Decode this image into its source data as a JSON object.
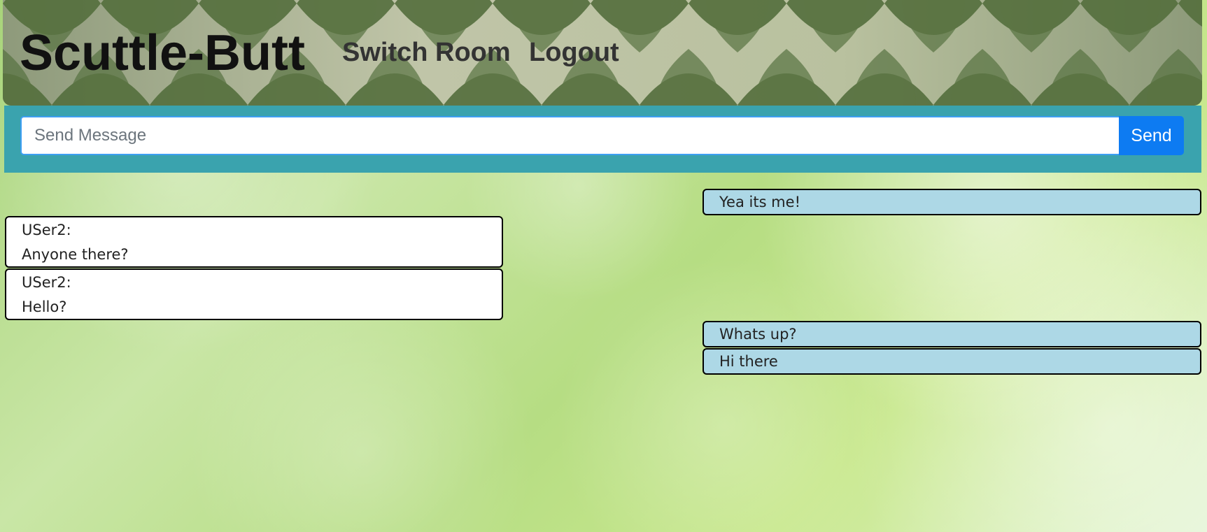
{
  "header": {
    "brand": "Scuttle-Butt",
    "nav": {
      "switch_room": "Switch Room",
      "logout": "Logout"
    }
  },
  "composer": {
    "placeholder": "Send Message",
    "value": "",
    "send_label": "Send"
  },
  "messages": {
    "sent": [
      {
        "text": "Yea its me!"
      },
      {
        "text": "Whats up?"
      },
      {
        "text": "Hi there"
      }
    ],
    "received": [
      {
        "user": "USer2:",
        "text": "Anyone there?"
      },
      {
        "user": "USer2:",
        "text": "Hello?"
      }
    ]
  },
  "colors": {
    "composer_bar": "#3aa3ae",
    "send_button": "#0d7bf2",
    "sent_bubble": "#add8e6",
    "received_bubble": "#ffffff",
    "leaf_dark": "#55703f"
  }
}
